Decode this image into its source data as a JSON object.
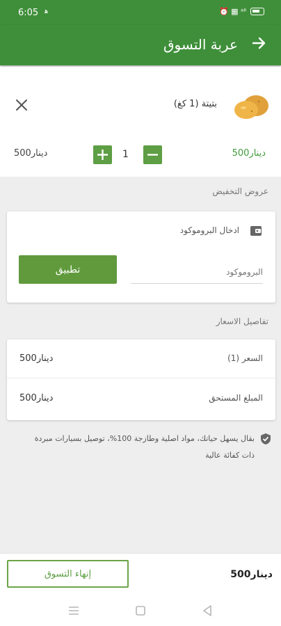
{
  "status_bar": {
    "time": "6:05",
    "tiny": "ﻫ",
    "indicators": "⏰ ▦ ᵃˡˡ"
  },
  "header": {
    "title": "عربة التسوق"
  },
  "cart_item": {
    "name": "بتيتة (1 كغ)",
    "unit_price": "500دينار",
    "quantity": "1",
    "line_total": "500دينار"
  },
  "discounts": {
    "section_label": "عروض التخفيض",
    "promo_title": "ادخال البروموكود",
    "promo_placeholder": "البروموكود",
    "apply_label": "تطبيق"
  },
  "price_details": {
    "section_label": "تفاصيل الاسعار",
    "rows": [
      {
        "label": "السعر (1)",
        "value": "500دينار"
      },
      {
        "label": "المبلغ المستحق",
        "value": "500دينار"
      }
    ]
  },
  "guarantee": {
    "text": "بقال يسهل حياتك، مواد اصلية وطازجة 100%، توصيل بسيارات مبردة ذات كفائة عالية"
  },
  "footer": {
    "finish_label": "إنهاء التسوق",
    "total": "500دينار"
  },
  "colors": {
    "brand": "#3f8f3a",
    "button": "#609a3c",
    "price_green": "#3f9a3a"
  },
  "icons": [
    "back-arrow-icon",
    "close-icon",
    "potato-icon",
    "plus-icon",
    "minus-icon",
    "wallet-icon",
    "shield-check-icon",
    "menu-icon",
    "home-icon",
    "back-icon"
  ]
}
